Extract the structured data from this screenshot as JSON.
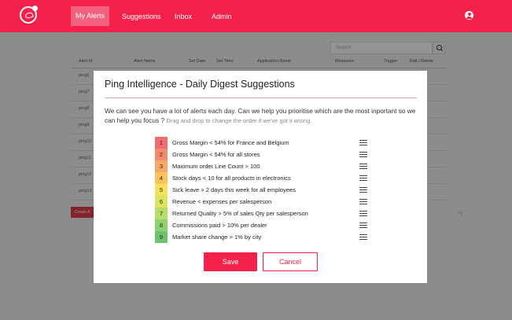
{
  "nav": {
    "items": [
      "My Alerts",
      "Suggestions",
      "Inbox",
      "Admin"
    ],
    "brand_color": "#f5214a"
  },
  "search": {
    "placeholder": "Search"
  },
  "table": {
    "headers": [
      "Alert Id",
      "Alert Name",
      "Set Date",
      "Set Time",
      "Application Name",
      "Measures",
      "Trigger",
      "Edit / Delete"
    ],
    "rows": [
      "ping6",
      "ping7",
      "ping8",
      "ping9",
      "ping10",
      "ping11",
      "ping12",
      "ping13"
    ]
  },
  "create_button": "Create A",
  "pager": ">|",
  "modal": {
    "title": "Ping Intelligence - Daily Digest Suggestions",
    "intro": "We can see you have a lot of alerts each day. Can we help you prioritise which are the most inportant so we can help you focus ?",
    "hint": "Drag and drop to change the order if we've got it wrong.",
    "items": [
      {
        "num": "1",
        "label": "Gross Margin < 54% for France and Belgium",
        "color": "#f26d6d"
      },
      {
        "num": "2",
        "label": "Gross Margin < 54% for all stores",
        "color": "#f58a6e"
      },
      {
        "num": "3",
        "label": "Maximum order Line Count > 100",
        "color": "#f7a867"
      },
      {
        "num": "4",
        "label": "Stock days < 10 for all products in electronics",
        "color": "#fac35f"
      },
      {
        "num": "5",
        "label": "Sick leave > 2 days this week for all employees",
        "color": "#f6e25c"
      },
      {
        "num": "6",
        "label": "Revenue < expenses per salesperson",
        "color": "#dbe45f"
      },
      {
        "num": "7",
        "label": "Returned Quality > 5% of sales Qty per salesperson",
        "color": "#b6dc6a"
      },
      {
        "num": "8",
        "label": "Commissions paid > 10% per dealer",
        "color": "#8fd16f"
      },
      {
        "num": "9",
        "label": "Market share change > 1% by city",
        "color": "#6cc56e"
      }
    ],
    "save_label": "Save",
    "cancel_label": "Cancel"
  },
  "icons": {
    "logo": "logo-icon",
    "user": "user-icon",
    "search": "search-icon",
    "drag": "drag-handle-icon"
  }
}
